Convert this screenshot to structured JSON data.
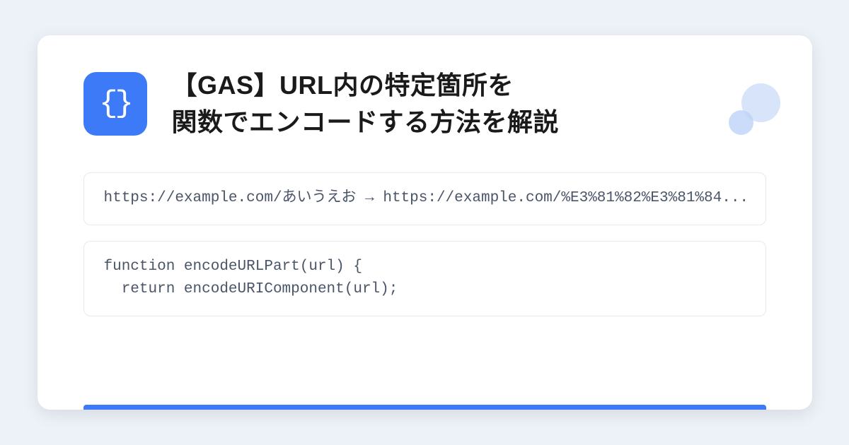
{
  "icon": "braces",
  "title_line1": "【GAS】URL内の特定箇所を",
  "title_line2": "関数でエンコードする方法を解説",
  "example": {
    "text": "https://example.com/あいうえお → https://example.com/%E3%81%82%E3%81%84..."
  },
  "code": {
    "line1": "function encodeURLPart(url) {",
    "line2": "  return encodeURIComponent(url);"
  },
  "colors": {
    "accent": "#3c7af7",
    "background": "#edf2f9"
  }
}
